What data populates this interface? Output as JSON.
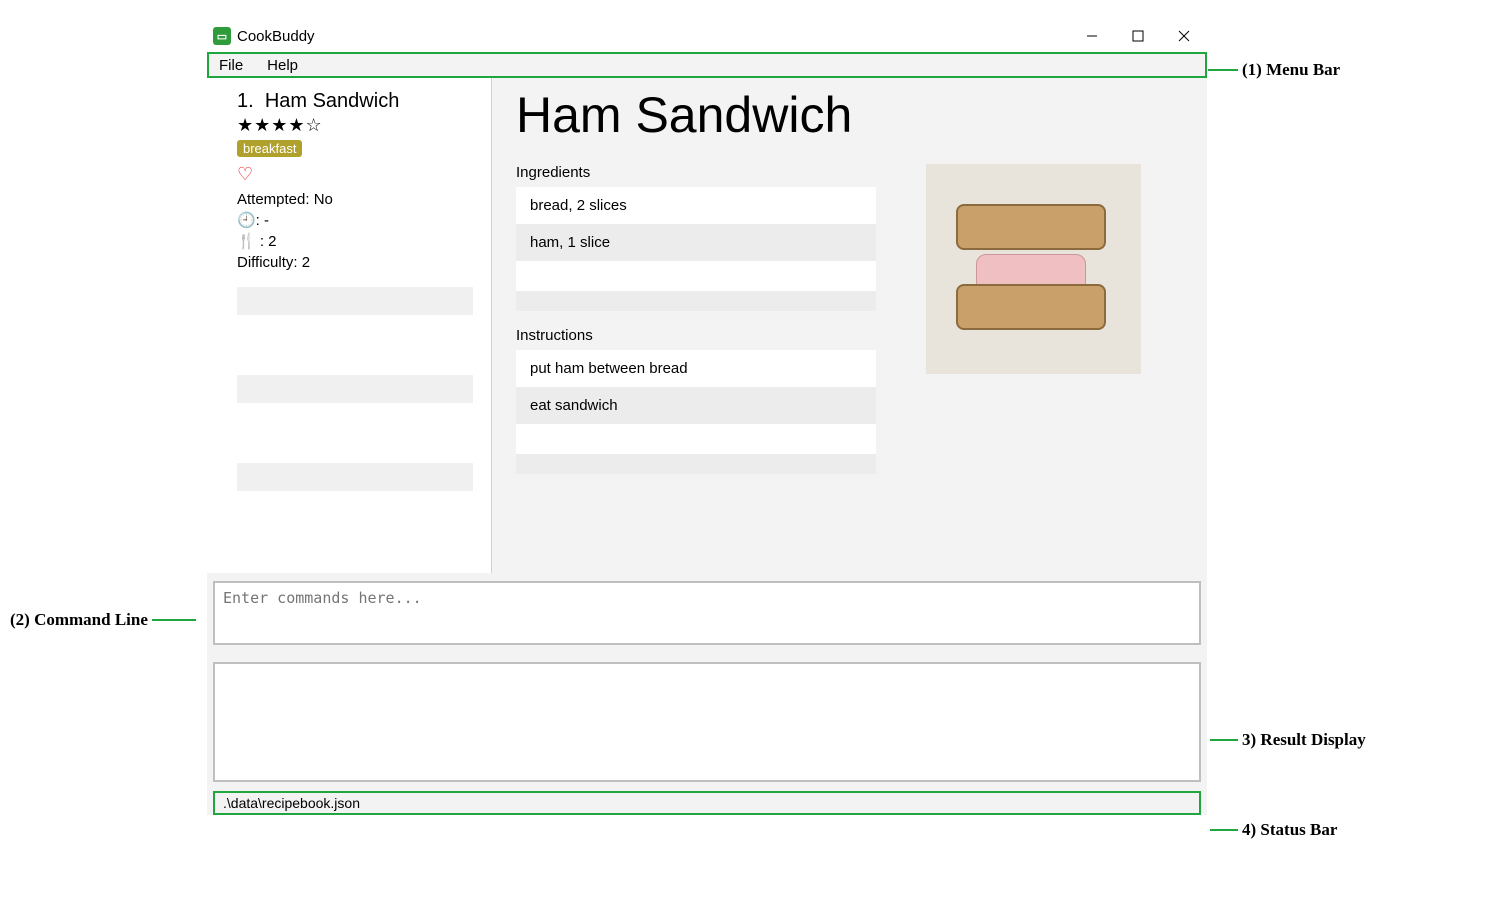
{
  "window": {
    "title": "CookBuddy"
  },
  "menubar": {
    "items": [
      "File",
      "Help"
    ]
  },
  "sidebar": {
    "recipe": {
      "index": "1.",
      "name": "Ham Sandwich",
      "stars": "★★★★☆",
      "tag": "breakfast",
      "heart": "♡",
      "attempted_label": "Attempted: No",
      "time_label": "🕘: -",
      "servings_label": "🍴 : 2",
      "difficulty_label": "Difficulty: 2"
    }
  },
  "detail": {
    "title": "Ham Sandwich",
    "ingredients_label": "Ingredients",
    "ingredients": [
      "bread, 2 slices",
      "ham, 1 slice"
    ],
    "instructions_label": "Instructions",
    "instructions": [
      "put ham between bread",
      "eat sandwich"
    ]
  },
  "command": {
    "placeholder": "Enter commands here..."
  },
  "statusbar": {
    "text": ".\\data\\recipebook.json"
  },
  "annotations": {
    "a1": "(1) Menu Bar",
    "a2": "(2) Command Line",
    "a3": "3) Result Display",
    "a4": "4) Status Bar"
  }
}
